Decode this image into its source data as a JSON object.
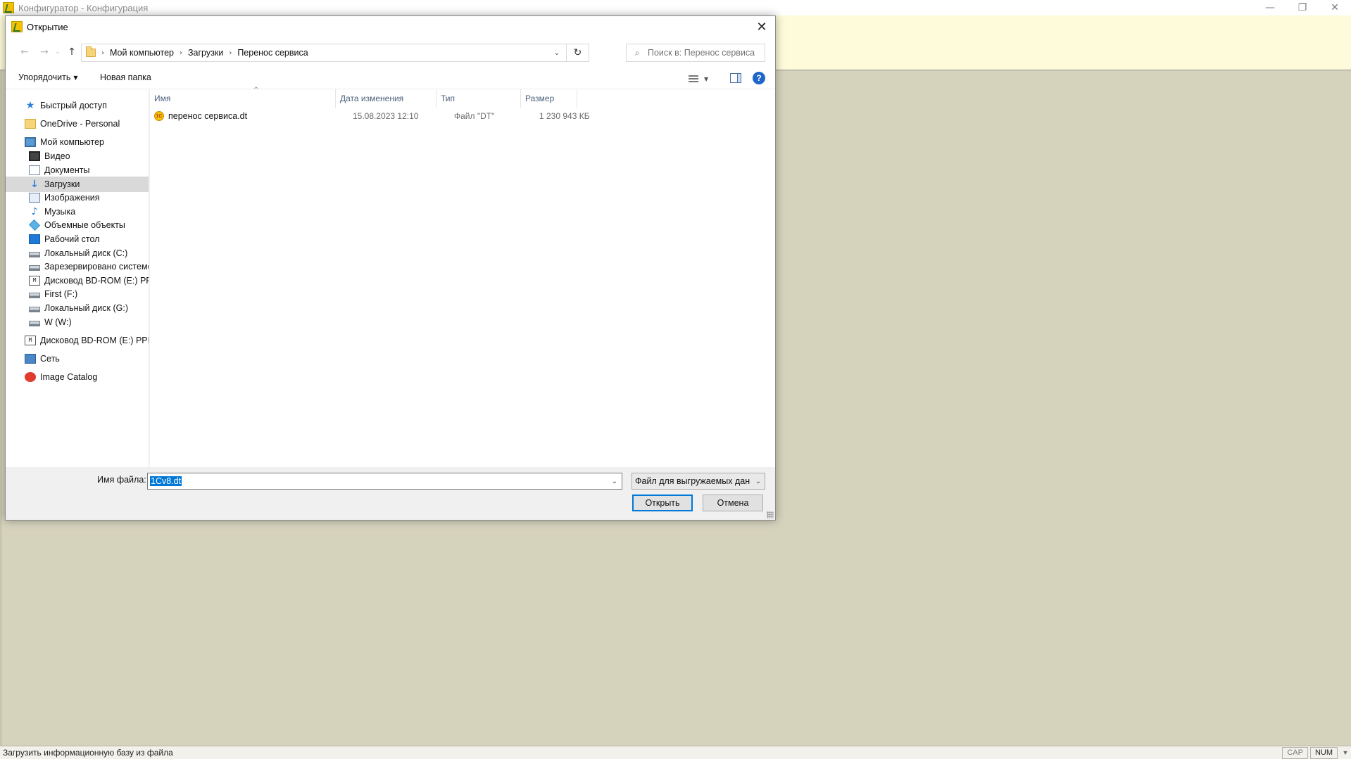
{
  "app": {
    "title": "Конфигуратор - Конфигурация",
    "minimize": "—",
    "restore": "❐",
    "close": "✕"
  },
  "status": {
    "text": "Загрузить информационную базу из файла",
    "cap": "CAP",
    "num": "NUM",
    "arrow": "▼"
  },
  "dialog": {
    "title": "Открытие",
    "close": "✕",
    "nav": {
      "back": "←",
      "forward": "→",
      "recent": "⌄",
      "up": "↑"
    },
    "breadcrumb": [
      "Мой компьютер",
      "Загрузки",
      "Перенос сервиса"
    ],
    "crumb_sep": "›",
    "address_drop": "⌄",
    "refresh": "↻",
    "search": {
      "icon": "⌕",
      "placeholder": "Поиск в: Перенос сервиса"
    },
    "toolbar": {
      "organize": "Упорядочить",
      "organize_caret": "▼",
      "new_folder": "Новая папка",
      "view_caret": "▼",
      "help": "?"
    },
    "tree": [
      {
        "label": "Быстрый доступ",
        "icon": "star-icon",
        "glyph": "★",
        "indent": 0
      },
      {
        "label": "OneDrive - Personal",
        "icon": "folder-icon",
        "glyph": "",
        "indent": 0
      },
      {
        "label": "Мой компьютер",
        "icon": "computer-icon",
        "glyph": "",
        "indent": 0
      },
      {
        "label": "Видео",
        "icon": "video-icon",
        "glyph": "",
        "indent": 1
      },
      {
        "label": "Документы",
        "icon": "document-icon",
        "glyph": "",
        "indent": 1
      },
      {
        "label": "Загрузки",
        "icon": "download-icon",
        "glyph": "↓",
        "indent": 1,
        "selected": true
      },
      {
        "label": "Изображения",
        "icon": "image-icon",
        "glyph": "",
        "indent": 1
      },
      {
        "label": "Музыка",
        "icon": "music-icon",
        "glyph": "♪",
        "indent": 1
      },
      {
        "label": "Объемные объекты",
        "icon": "cube-icon",
        "glyph": "",
        "indent": 1
      },
      {
        "label": "Рабочий стол",
        "icon": "desktop-icon",
        "glyph": "",
        "indent": 1
      },
      {
        "label": "Локальный диск (C:)",
        "icon": "disk-icon",
        "glyph": "",
        "indent": 1
      },
      {
        "label": "Зарезервировано системой",
        "icon": "disk-icon",
        "glyph": "",
        "indent": 1
      },
      {
        "label": "Дисковод BD-ROM (E:) PPRO",
        "icon": "cd-drive-icon",
        "glyph": "M",
        "indent": 1
      },
      {
        "label": "First (F:)",
        "icon": "disk-icon",
        "glyph": "",
        "indent": 1
      },
      {
        "label": "Локальный диск (G:)",
        "icon": "disk-icon",
        "glyph": "",
        "indent": 1
      },
      {
        "label": "W (W:)",
        "icon": "disk-icon",
        "glyph": "",
        "indent": 1
      },
      {
        "label": "Дисковод BD-ROM (E:) PPRO",
        "icon": "cd-drive-icon",
        "glyph": "M",
        "indent": 0
      },
      {
        "label": "Сеть",
        "icon": "network-icon",
        "glyph": "",
        "indent": 0
      },
      {
        "label": "Image Catalog",
        "icon": "image-catalog-icon",
        "glyph": "",
        "indent": 0
      }
    ],
    "columns": {
      "name": "Имя",
      "sort_caret": "^",
      "date": "Дата изменения",
      "type": "Тип",
      "size": "Размер"
    },
    "files": [
      {
        "name": "перенос сервиса.dt",
        "date": "15.08.2023 12:10",
        "type": "Файл \"DT\"",
        "size": "1 230 943 КБ",
        "icon_text": "1С"
      }
    ],
    "filename": {
      "label": "Имя файла:",
      "value": "1Cv8.dt",
      "drop": "⌄"
    },
    "filetype": {
      "value": "Файл для выгружаемых данных",
      "drop": "⌄"
    },
    "buttons": {
      "open": "Открыть",
      "cancel": "Отмена"
    }
  }
}
